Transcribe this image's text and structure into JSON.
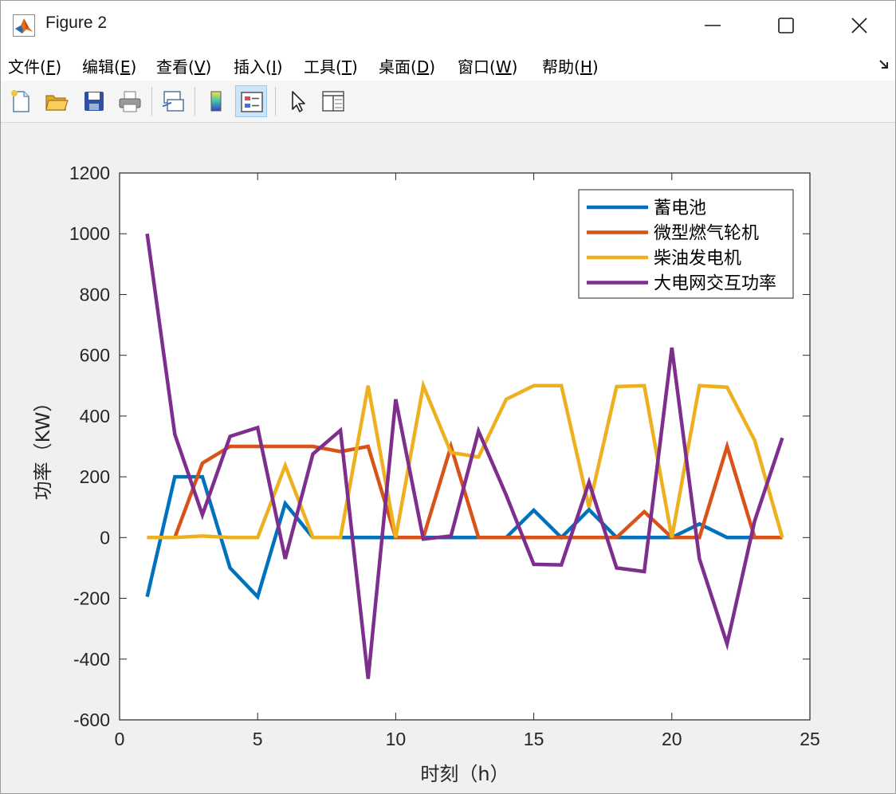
{
  "window": {
    "title": "Figure 2",
    "minimize_icon": "minimize-icon",
    "maximize_icon": "maximize-icon",
    "close_icon": "close-icon"
  },
  "menu": {
    "items": [
      {
        "label": "文件(",
        "acc": "F",
        "end": ")"
      },
      {
        "label": "编辑(",
        "acc": "E",
        "end": ")"
      },
      {
        "label": "查看(",
        "acc": "V",
        "end": ")"
      },
      {
        "label": "插入(",
        "acc": "I",
        "end": ")"
      },
      {
        "label": "工具(",
        "acc": "T",
        "end": ")"
      },
      {
        "label": "桌面(",
        "acc": "D",
        "end": ")"
      },
      {
        "label": "窗口(",
        "acc": "W",
        "end": ")"
      },
      {
        "label": "帮助(",
        "acc": "H",
        "end": ")"
      }
    ]
  },
  "toolbar": {
    "tools": [
      "new-figure-icon",
      "open-file-icon",
      "save-icon",
      "print-icon",
      "link-plot-icon",
      "colorbar-icon",
      "legend-icon",
      "pointer-icon",
      "property-inspector-icon"
    ]
  },
  "chart_data": {
    "type": "line",
    "title": "",
    "xlabel": "时刻（h）",
    "ylabel": "功率（KW）",
    "xlim": [
      0,
      25
    ],
    "ylim": [
      -600,
      1200
    ],
    "xticks": [
      0,
      5,
      10,
      15,
      20,
      25
    ],
    "yticks": [
      -600,
      -400,
      -200,
      0,
      200,
      400,
      600,
      800,
      1000,
      1200
    ],
    "grid": false,
    "legend_position": "top-right",
    "x": [
      1,
      2,
      3,
      4,
      5,
      6,
      7,
      8,
      9,
      10,
      11,
      12,
      13,
      14,
      15,
      16,
      17,
      18,
      19,
      20,
      21,
      22,
      23,
      24
    ],
    "series": [
      {
        "name": "蓄电池",
        "color": "#0072BD",
        "values": [
          -195,
          200,
          200,
          -100,
          -195,
          112,
          0,
          0,
          0,
          0,
          0,
          0,
          0,
          0,
          90,
          0,
          92,
          0,
          0,
          0,
          45,
          0,
          0,
          0
        ]
      },
      {
        "name": "微型燃气轮机",
        "color": "#D95319",
        "values": [
          0,
          0,
          245,
          300,
          300,
          300,
          300,
          283,
          300,
          0,
          0,
          300,
          0,
          0,
          0,
          0,
          0,
          0,
          85,
          0,
          0,
          300,
          0,
          0
        ]
      },
      {
        "name": "柴油发电机",
        "color": "#EDB120",
        "values": [
          0,
          0,
          5,
          0,
          0,
          237,
          0,
          0,
          500,
          0,
          500,
          280,
          265,
          455,
          500,
          500,
          100,
          497,
          500,
          0,
          500,
          495,
          320,
          0
        ]
      },
      {
        "name": "大电网交互功率",
        "color": "#7E2F8E",
        "values": [
          1000,
          340,
          75,
          333,
          362,
          -70,
          275,
          353,
          -465,
          455,
          -5,
          5,
          350,
          140,
          -88,
          -90,
          182,
          -100,
          -112,
          625,
          -70,
          -350,
          55,
          328
        ]
      }
    ]
  }
}
